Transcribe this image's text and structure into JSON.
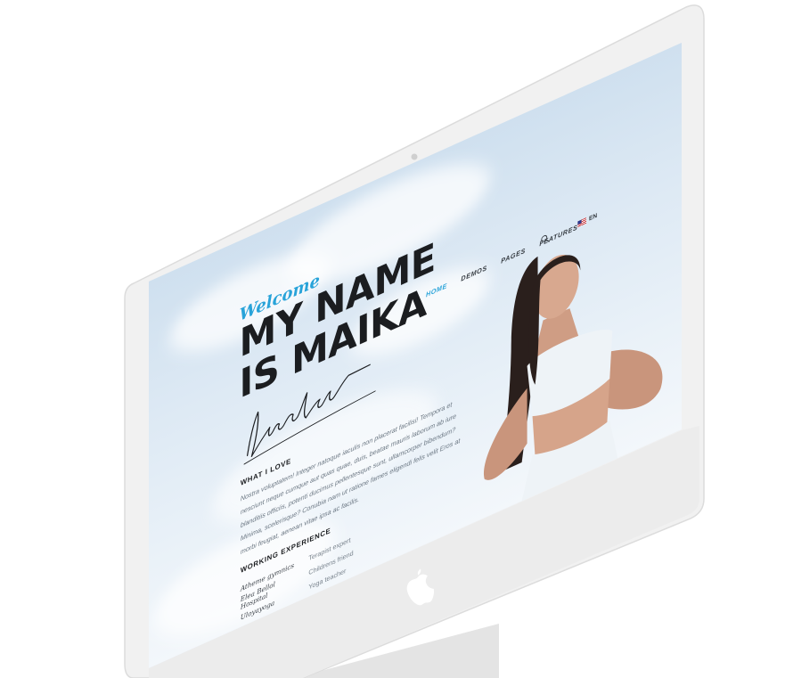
{
  "nav": {
    "items": [
      {
        "label": "HOME",
        "active": true
      },
      {
        "label": "DEMOS",
        "active": false
      },
      {
        "label": "PAGES",
        "active": false
      },
      {
        "label": "FEATURES",
        "active": false
      }
    ],
    "search_icon": "search-icon",
    "language": "EN",
    "flag_icon": "us-flag-icon"
  },
  "hero": {
    "welcome": "Welcome",
    "line1": "MY NAME",
    "line2": "IS MAIKA"
  },
  "what_i_love": {
    "title": "WHAT I LOVE",
    "text": "Nostra voluptatem! Integer natoque iaculis non placerat facilisi! Tempora et nesciunt neque cumque aut quas quae, duis, beatae mauris laborum ab iure blanditiis officiis, potenti ducimus pellentesque sunt, ullamcorper bibendum? Minima, scelerisque? Conubia nam ut ratione fames eligendi felis velit Eros at morbi feugiat, aenean vitae ipsa ac facilis."
  },
  "working_experience": {
    "title": "WORKING EXPERIENCE",
    "rows": [
      {
        "place": "Atheme gymnics",
        "role": "Terapist expert"
      },
      {
        "place": "Elea Bellol Hospital",
        "role": "Childrens friend"
      },
      {
        "place": "Uloyayoga",
        "role": "Yoga teacher"
      }
    ]
  },
  "colors": {
    "accent": "#28a3d9",
    "headline": "#1b1d20",
    "monitor": "#ececec"
  },
  "icons": [
    "search-icon",
    "apple-logo-icon",
    "camera-icon",
    "signature"
  ]
}
